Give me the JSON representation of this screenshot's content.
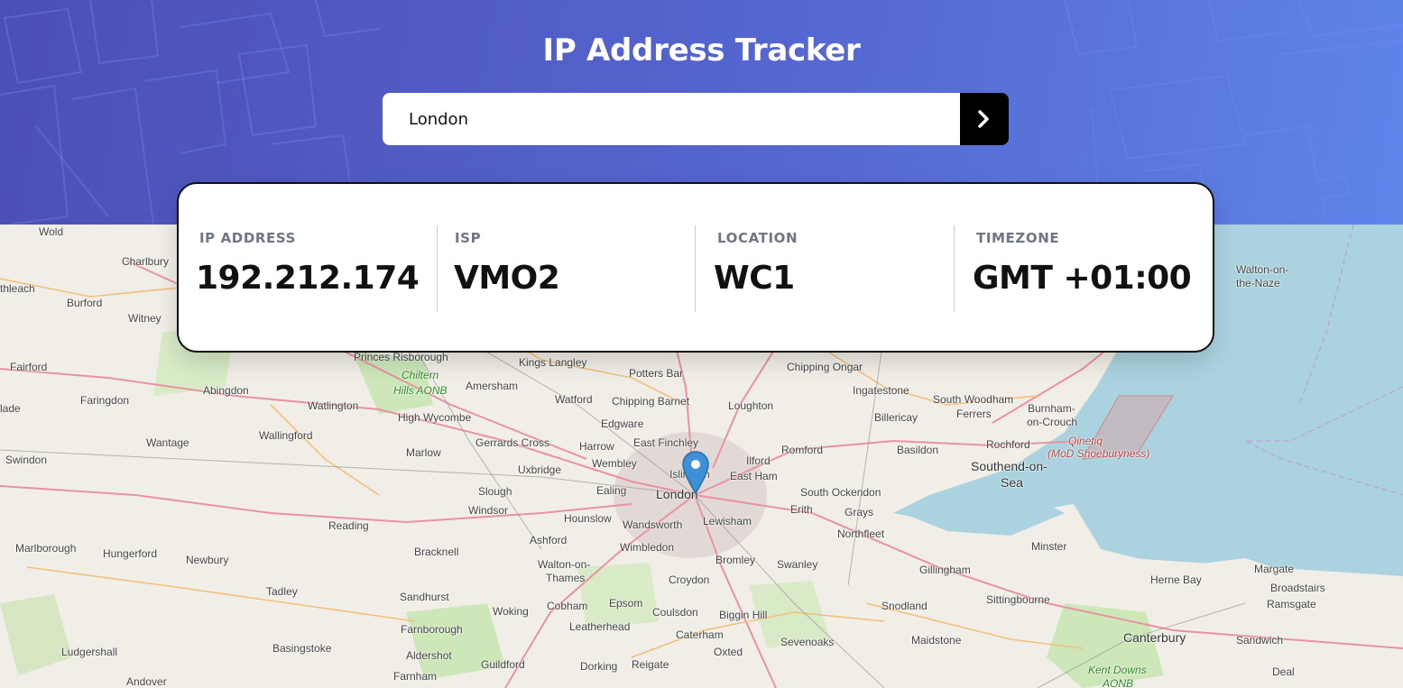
{
  "header": {
    "title": "IP Address Tracker"
  },
  "search": {
    "value": "London",
    "submit_icon": "chevron-right-icon"
  },
  "info": {
    "ip": {
      "label": "IP ADDRESS",
      "value": "192.212.174"
    },
    "isp": {
      "label": "ISP",
      "value": "VMO2"
    },
    "location": {
      "label": "LOCATION",
      "value": "WC1"
    },
    "timezone": {
      "label": "TIMEZONE",
      "value": "GMT +01:00"
    }
  },
  "map": {
    "marker_icon": "map-marker-icon",
    "places": [
      "Wold",
      "Charlbury",
      "thleach",
      "Burford",
      "Witney",
      "Fairford",
      "Faringdon",
      "Abingdon",
      "lade",
      "Wantage",
      "Swindon",
      "Marlborough",
      "Hungerford",
      "Newbury",
      "Tadley",
      "Ludgershall",
      "Andover",
      "Reading",
      "Basingstoke",
      "Princes Risborough",
      "Chiltern",
      "Hills AONB",
      "Watlington",
      "Wallingford",
      "High Wycombe",
      "Marlow",
      "Amersham",
      "Kings Langley",
      "Potters Bar",
      "Watford",
      "Chipping Barnet",
      "Edgware",
      "Gerrards Cross",
      "Harrow",
      "Uxbridge",
      "Slough",
      "Windsor",
      "Wembley",
      "Ealing",
      "Hounslow",
      "East Finchley",
      "Islington",
      "London",
      "Wandsworth",
      "Lewisham",
      "Ilford",
      "East Ham",
      "Loughton",
      "Romford",
      "Chipping Ongar",
      "Ingatestone",
      "Billericay",
      "Basildon",
      "Rochford",
      "Southend-on-",
      "Sea",
      "South Woodham",
      "Ferrers",
      "Burnham-",
      "on-Crouch",
      "Qinetiq",
      "(MoD Shoeburyness)",
      "Walton-on-",
      "the-Naze",
      "South Ockendon",
      "Erith",
      "Grays",
      "Northfleet",
      "Minster",
      "Gillingham",
      "Sittingbourne",
      "Herne Bay",
      "Margate",
      "Broadstairs",
      "Ramsgate",
      "Canterbury",
      "Sandwich",
      "Deal",
      "Kent Downs",
      "AONB",
      "Maidstone",
      "Snodland",
      "Sevenoaks",
      "Oxted",
      "Caterham",
      "Biggin Hill",
      "Coulsdon",
      "Croydon",
      "Bromley",
      "Swanley",
      "Wimbledon",
      "Walton-on-",
      "Thames",
      "Ashford",
      "Bracknell",
      "Sandhurst",
      "Farnborough",
      "Aldershot",
      "Woking",
      "Cobham",
      "Epsom",
      "Leatherhead",
      "Guildford",
      "Dorking",
      "Reigate",
      "Farnham"
    ]
  }
}
